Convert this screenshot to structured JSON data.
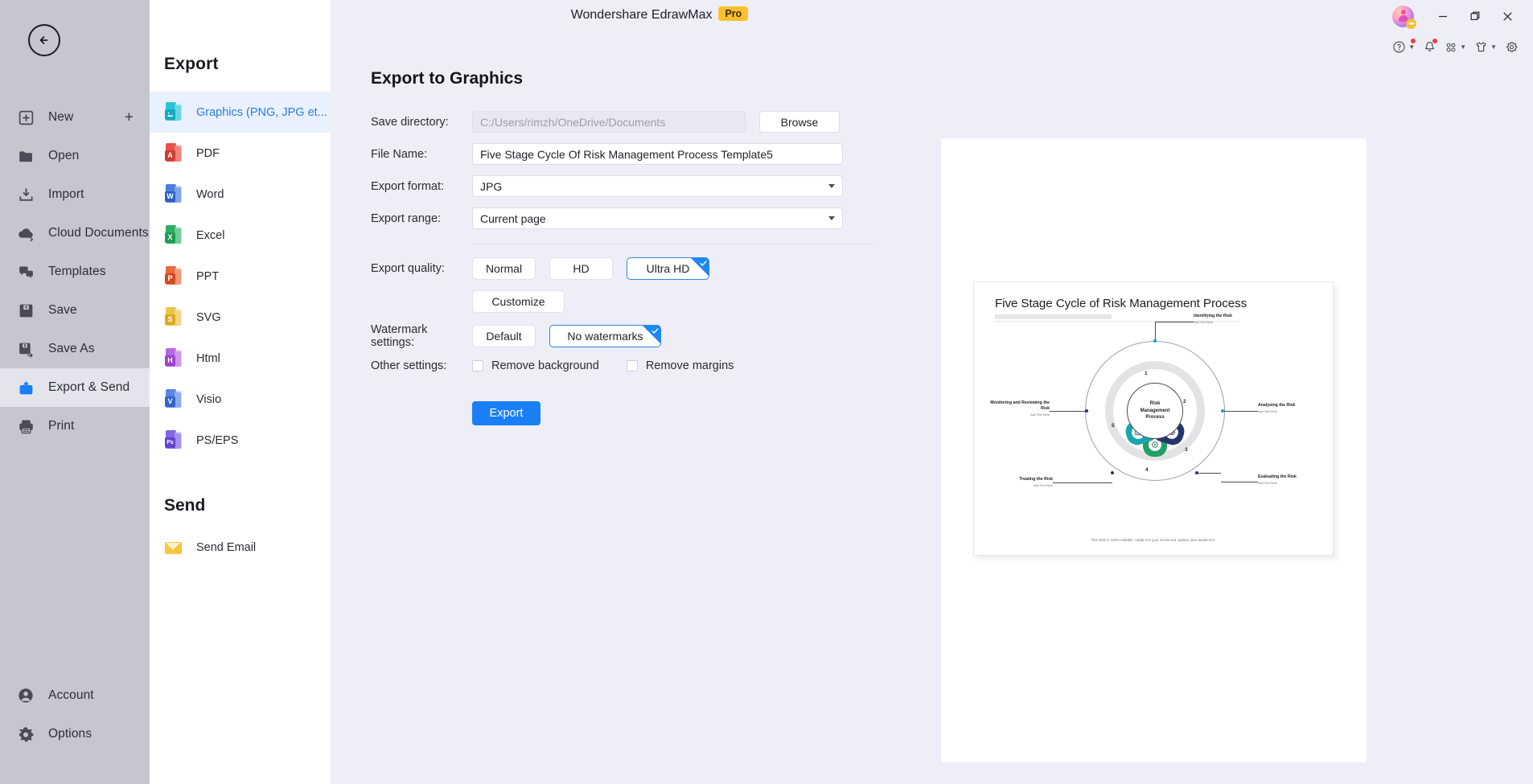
{
  "titlebar": {
    "app_title": "Wondershare EdrawMax",
    "pro_badge": "Pro",
    "minimize": "Minimize",
    "maximize": "Restore",
    "close": "Close"
  },
  "rail": {
    "back_label": "Back",
    "items": [
      {
        "label": "New",
        "icon": "new-icon",
        "active": false,
        "trailing": "+"
      },
      {
        "label": "Open",
        "icon": "folder-icon",
        "active": false
      },
      {
        "label": "Import",
        "icon": "import-icon",
        "active": false
      },
      {
        "label": "Cloud Documents",
        "icon": "cloud-icon",
        "active": false
      },
      {
        "label": "Templates",
        "icon": "templates-icon",
        "active": false
      },
      {
        "label": "Save",
        "icon": "save-icon",
        "active": false
      },
      {
        "label": "Save As",
        "icon": "save-as-icon",
        "active": false
      },
      {
        "label": "Export & Send",
        "icon": "export-send-icon",
        "active": true
      },
      {
        "label": "Print",
        "icon": "print-icon",
        "active": false
      }
    ],
    "bottom_items": [
      {
        "label": "Account",
        "icon": "account-icon"
      },
      {
        "label": "Options",
        "icon": "gear-icon"
      }
    ]
  },
  "panel": {
    "title": "Export",
    "items": [
      {
        "label": "Graphics (PNG, JPG et...",
        "icon": "graphics-file-icon",
        "color": "#27c4d9",
        "letter": "",
        "active": true
      },
      {
        "label": "PDF",
        "icon": "pdf-file-icon",
        "color": "#e8524a",
        "letter": "A",
        "active": false
      },
      {
        "label": "Word",
        "icon": "word-file-icon",
        "color": "#2b5fc4",
        "letter": "W",
        "active": false
      },
      {
        "label": "Excel",
        "icon": "excel-file-icon",
        "color": "#1f9c52",
        "letter": "X",
        "active": false
      },
      {
        "label": "PPT",
        "icon": "ppt-file-icon",
        "color": "#e2542a",
        "letter": "P",
        "active": false
      },
      {
        "label": "SVG",
        "icon": "svg-file-icon",
        "color": "#e8b62b",
        "letter": "S",
        "active": false
      },
      {
        "label": "Html",
        "icon": "html-file-icon",
        "color": "#a64bd6",
        "letter": "H",
        "active": false
      },
      {
        "label": "Visio",
        "icon": "visio-file-icon",
        "color": "#3f6fd8",
        "letter": "V",
        "active": false
      },
      {
        "label": "PS/EPS",
        "icon": "ps-eps-file-icon",
        "color": "#6c4ddb",
        "letter": "Ps",
        "active": false
      }
    ],
    "send_title": "Send",
    "send_items": [
      {
        "label": "Send Email",
        "icon": "envelope-icon"
      }
    ]
  },
  "toolbar": {
    "help": "help-icon",
    "notifications": "bell-icon",
    "apps": "apps-grid-icon",
    "theme": "theme-shirt-icon",
    "settings": "gear-icon"
  },
  "form": {
    "heading": "Export to Graphics",
    "save_directory_label": "Save directory:",
    "save_directory_value": "C:/Users/rimzh/OneDrive/Documents",
    "browse_label": "Browse",
    "file_name_label": "File Name:",
    "file_name_value": "Five Stage Cycle Of Risk Management Process Template5",
    "export_format_label": "Export format:",
    "export_format_value": "JPG",
    "export_range_label": "Export range:",
    "export_range_value": "Current page",
    "export_quality_label": "Export quality:",
    "quality_options": [
      {
        "label": "Normal",
        "selected": false
      },
      {
        "label": "HD",
        "selected": false
      },
      {
        "label": "Ultra HD",
        "selected": true
      }
    ],
    "customize_label": "Customize",
    "watermark_label": "Watermark settings:",
    "watermark_options": [
      {
        "label": "Default",
        "selected": false
      },
      {
        "label": "No watermarks",
        "selected": true
      }
    ],
    "other_settings_label": "Other settings:",
    "checkboxes": [
      {
        "label": "Remove background",
        "checked": false
      },
      {
        "label": "Remove margins",
        "checked": false
      }
    ],
    "export_button_label": "Export"
  },
  "preview": {
    "slide_title": "Five Stage Cycle of Risk Management Process",
    "hub_line1": "Risk",
    "hub_line2": "Management",
    "hub_line3": "Process",
    "footer": "This slide is 100% editable. Adapt it to your needs and capture your audience's.",
    "stages": [
      {
        "num": "1",
        "title": "Identifying the Risk",
        "sub": "Add Text Here",
        "color": "#21a065"
      },
      {
        "num": "2",
        "title": "Analysing the Risk",
        "sub": "Add Text Here",
        "color": "#1aa6ae"
      },
      {
        "num": "3",
        "title": "Evaluating the Risk",
        "sub": "Add Text Here",
        "color": "#1c5fa8"
      },
      {
        "num": "4",
        "title": "Treating the Risk",
        "sub": "Add Text Here",
        "color": "#1d5fc0"
      },
      {
        "num": "5",
        "title": "Monitoring and Reviewing the Risk",
        "sub": "Add Text Here",
        "color": "#26356e"
      }
    ]
  },
  "colors": {
    "accent": "#1a7ff5",
    "selected_border": "#2f86e8",
    "background": "#eeeef8",
    "rail": "#c6c6d0",
    "pro_badge": "#fbc02d",
    "link_active": "#2b7de0"
  }
}
